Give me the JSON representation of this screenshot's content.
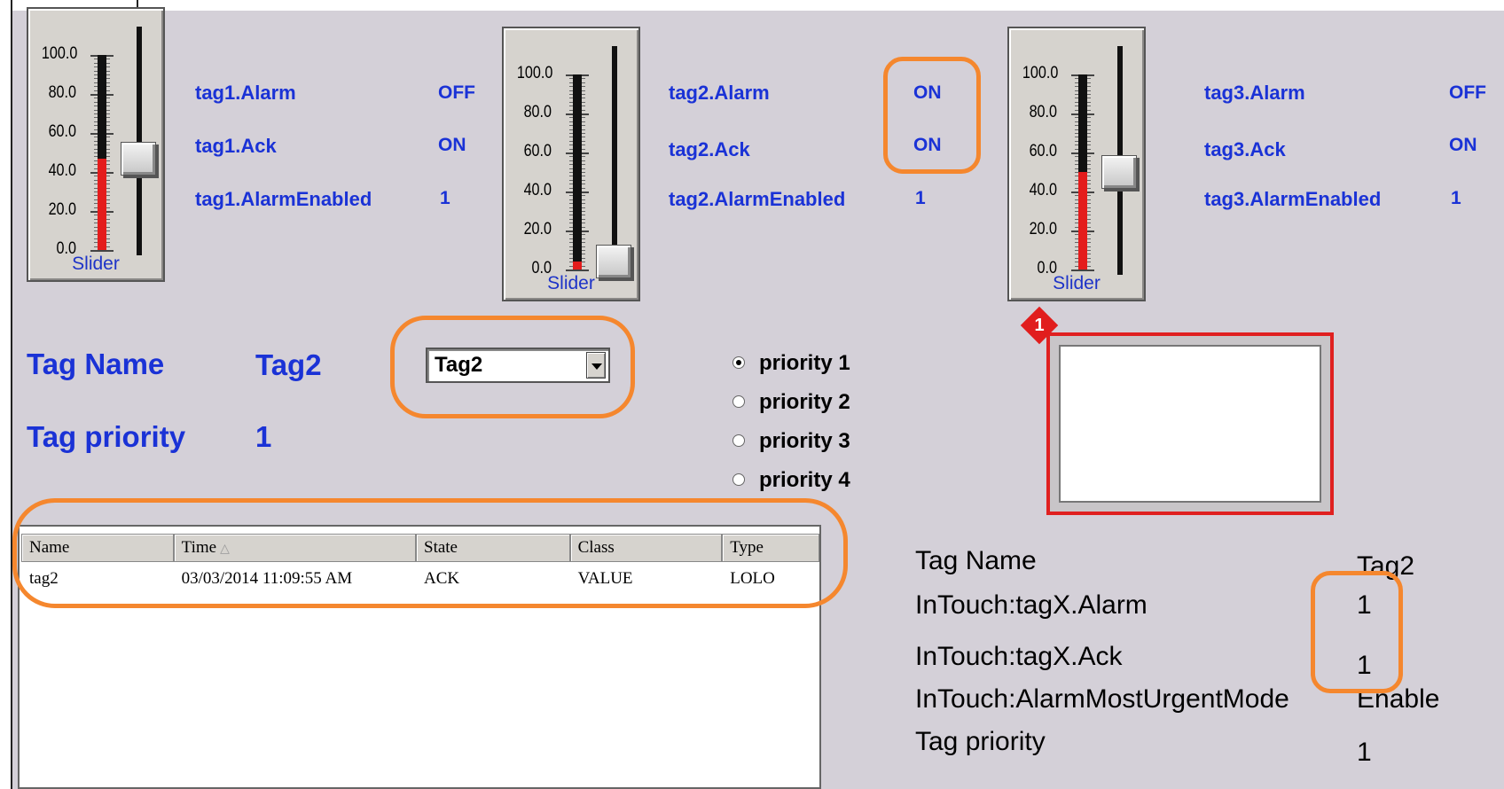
{
  "sliders": [
    {
      "caption": "Slider",
      "ticks": [
        "100.0",
        "80.0",
        "60.0",
        "40.0",
        "20.0",
        "0.0"
      ],
      "level": 47,
      "tags": [
        {
          "label": "tag1.Alarm",
          "value": "OFF"
        },
        {
          "label": "tag1.Ack",
          "value": "ON"
        },
        {
          "label": "tag1.AlarmEnabled",
          "value": "1"
        }
      ]
    },
    {
      "caption": "Slider",
      "ticks": [
        "100.0",
        "80.0",
        "60.0",
        "40.0",
        "20.0",
        "0.0"
      ],
      "level": 4,
      "tags": [
        {
          "label": "tag2.Alarm",
          "value": "ON"
        },
        {
          "label": "tag2.Ack",
          "value": "ON"
        },
        {
          "label": "tag2.AlarmEnabled",
          "value": "1"
        }
      ]
    },
    {
      "caption": "Slider",
      "ticks": [
        "100.0",
        "80.0",
        "60.0",
        "40.0",
        "20.0",
        "0.0"
      ],
      "level": 50,
      "tags": [
        {
          "label": "tag3.Alarm",
          "value": "OFF"
        },
        {
          "label": "tag3.Ack",
          "value": "ON"
        },
        {
          "label": "tag3.AlarmEnabled",
          "value": "1"
        }
      ]
    }
  ],
  "tag_name": {
    "label": "Tag Name",
    "value": "Tag2"
  },
  "tag_priority": {
    "label": "Tag priority",
    "value": "1"
  },
  "combo": {
    "selected": "Tag2"
  },
  "priorities": [
    {
      "label": "priority 1",
      "checked": true
    },
    {
      "label": "priority 2",
      "checked": false
    },
    {
      "label": "priority 3",
      "checked": false
    },
    {
      "label": "priority 4",
      "checked": false
    }
  ],
  "alarm_badge": "1",
  "alarm_grid": {
    "columns": [
      "Name",
      "Time",
      "State",
      "Class",
      "Type"
    ],
    "rows": [
      [
        "tag2",
        "03/03/2014 11:09:55 AM",
        "ACK",
        "VALUE",
        "LOLO"
      ]
    ]
  },
  "info_table": [
    {
      "label": "Tag Name",
      "value": "Tag2"
    },
    {
      "label": "InTouch:tagX.Alarm",
      "value": "1"
    },
    {
      "label": "InTouch:tagX.Ack",
      "value": "1"
    },
    {
      "label": "InTouch:AlarmMostUrgentMode",
      "value": "Enable"
    },
    {
      "label": "Tag priority",
      "value": "1"
    }
  ],
  "colors": {
    "label_blue": "#1a32d6",
    "highlight": "#f5872e",
    "alarm_red": "#e02020",
    "fill_red": "#e41c1c"
  }
}
